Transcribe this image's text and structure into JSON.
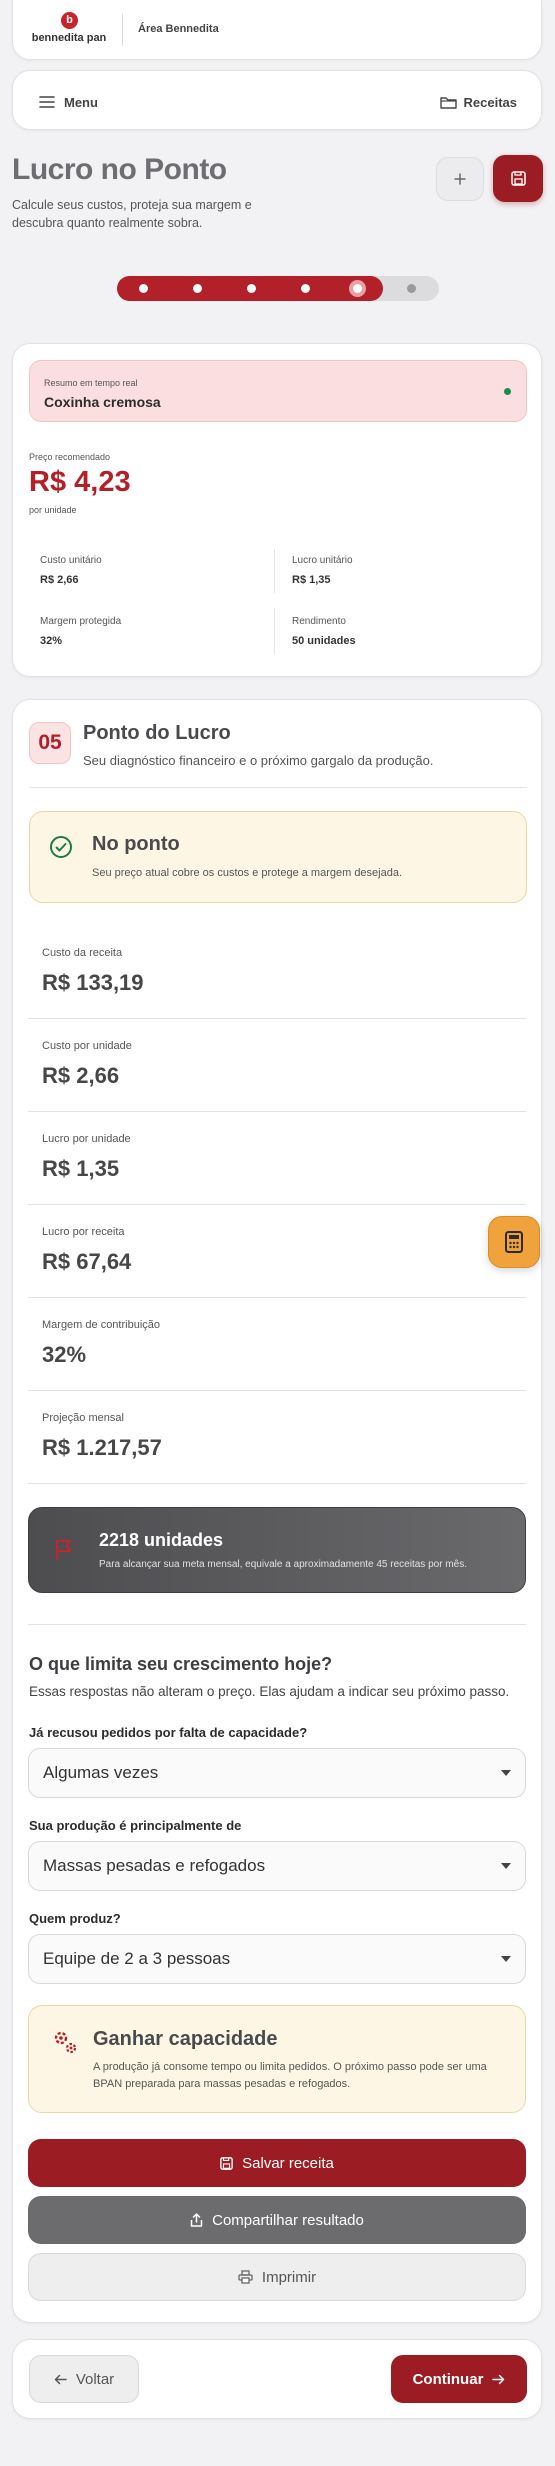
{
  "header": {
    "logo_text": "bennedita pan",
    "area_title": "Área Bennedita"
  },
  "nav": {
    "menu_label": "Menu",
    "recipes_label": "Receitas"
  },
  "page": {
    "title": "Lucro no Ponto",
    "subtitle": "Calcule seus custos, proteja sua margem e descubra quanto realmente sobra."
  },
  "progress": {
    "current_step": 5,
    "total_steps": 6
  },
  "summary": {
    "badge_label": "Resumo em tempo real",
    "recipe_name": "Coxinha cremosa",
    "price_label": "Preço recomendado",
    "price_value": "R$ 4,23",
    "price_unit": "por unidade",
    "stats": [
      {
        "label": "Custo unitário",
        "value": "R$ 2,66"
      },
      {
        "label": "Lucro unitário",
        "value": "R$ 1,35"
      },
      {
        "label": "Margem protegida",
        "value": "32%"
      },
      {
        "label": "Rendimento",
        "value": "50 unidades"
      }
    ]
  },
  "step": {
    "number": "05",
    "title": "Ponto do Lucro",
    "subtitle": "Seu diagnóstico financeiro e o próximo gargalo da produção."
  },
  "status": {
    "title": "No ponto",
    "description": "Seu preço atual cobre os custos e protege a margem desejada."
  },
  "metrics": [
    {
      "label": "Custo da receita",
      "value": "R$ 133,19"
    },
    {
      "label": "Custo por unidade",
      "value": "R$ 2,66"
    },
    {
      "label": "Lucro por unidade",
      "value": "R$ 1,35"
    },
    {
      "label": "Lucro por receita",
      "value": "R$ 67,64"
    },
    {
      "label": "Margem de contribuição",
      "value": "32%"
    },
    {
      "label": "Projeção mensal",
      "value": "R$ 1.217,57"
    }
  ],
  "goal": {
    "title": "2218 unidades",
    "description": "Para alcançar sua meta mensal, equivale a aproximadamente 45 receitas por mês."
  },
  "growth": {
    "title": "O que limita seu crescimento hoje?",
    "subtitle": "Essas respostas não alteram o preço. Elas ajudam a indicar seu próximo passo.",
    "questions": [
      {
        "label": "Já recusou pedidos por falta de capacidade?",
        "selected": "Algumas vezes"
      },
      {
        "label": "Sua produção é principalmente de",
        "selected": "Massas pesadas e refogados"
      },
      {
        "label": "Quem produz?",
        "selected": "Equipe de 2 a 3 pessoas"
      }
    ]
  },
  "recommendation": {
    "title": "Ganhar capacidade",
    "description": "A produção já consome tempo ou limita pedidos. O próximo passo pode ser uma BPAN preparada para massas pesadas e refogados."
  },
  "actions": {
    "save": "Salvar receita",
    "share": "Compartilhar resultado",
    "print": "Imprimir"
  },
  "footer": {
    "back": "Voltar",
    "continue": "Continuar"
  },
  "colors": {
    "brand_red": "#9b1c22",
    "status_green": "#1f8a4c",
    "calc_orange": "#f0a23c"
  },
  "icons": [
    "hamburger-icon",
    "folder-icon",
    "plus-icon",
    "save-icon",
    "check-circle-icon",
    "flag-icon",
    "chevron-down-icon",
    "gears-icon",
    "share-icon",
    "printer-icon",
    "arrow-left-icon",
    "arrow-right-icon",
    "calculator-icon"
  ]
}
